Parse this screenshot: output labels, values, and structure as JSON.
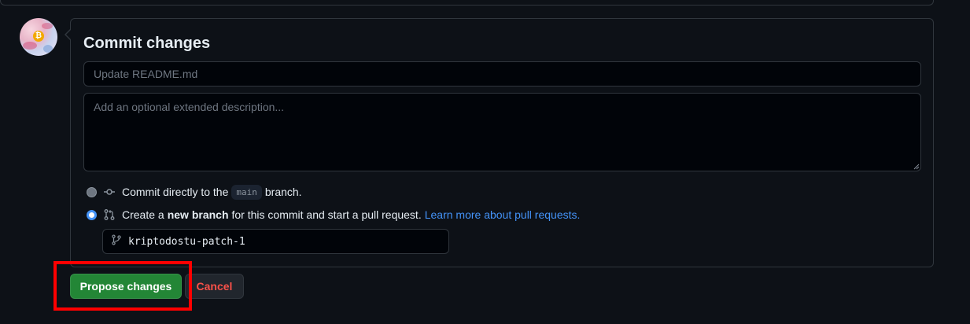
{
  "commit": {
    "title": "Commit changes",
    "summary_placeholder": "Update README.md",
    "summary_value": "",
    "description_placeholder": "Add an optional extended description...",
    "description_value": ""
  },
  "options": {
    "direct": {
      "label_prefix": "Commit directly to the",
      "branch": "main",
      "label_suffix": "branch.",
      "checked": false
    },
    "new_branch": {
      "label_prefix": "Create a",
      "label_bold": "new branch",
      "label_suffix": "for this commit and start a pull request.",
      "link": "Learn more about pull requests.",
      "checked": true
    },
    "branch_name": "kriptodostu-patch-1"
  },
  "actions": {
    "propose_label": "Propose changes",
    "cancel_label": "Cancel"
  },
  "icons": {
    "direct": "git-commit-icon",
    "new_branch": "git-pull-request-icon",
    "branch_field": "git-branch-icon"
  },
  "colors": {
    "background": "#0d1117",
    "primary_button": "#238636",
    "danger_text": "#f85149",
    "link": "#4493f8",
    "annotation": "#ff0000"
  }
}
